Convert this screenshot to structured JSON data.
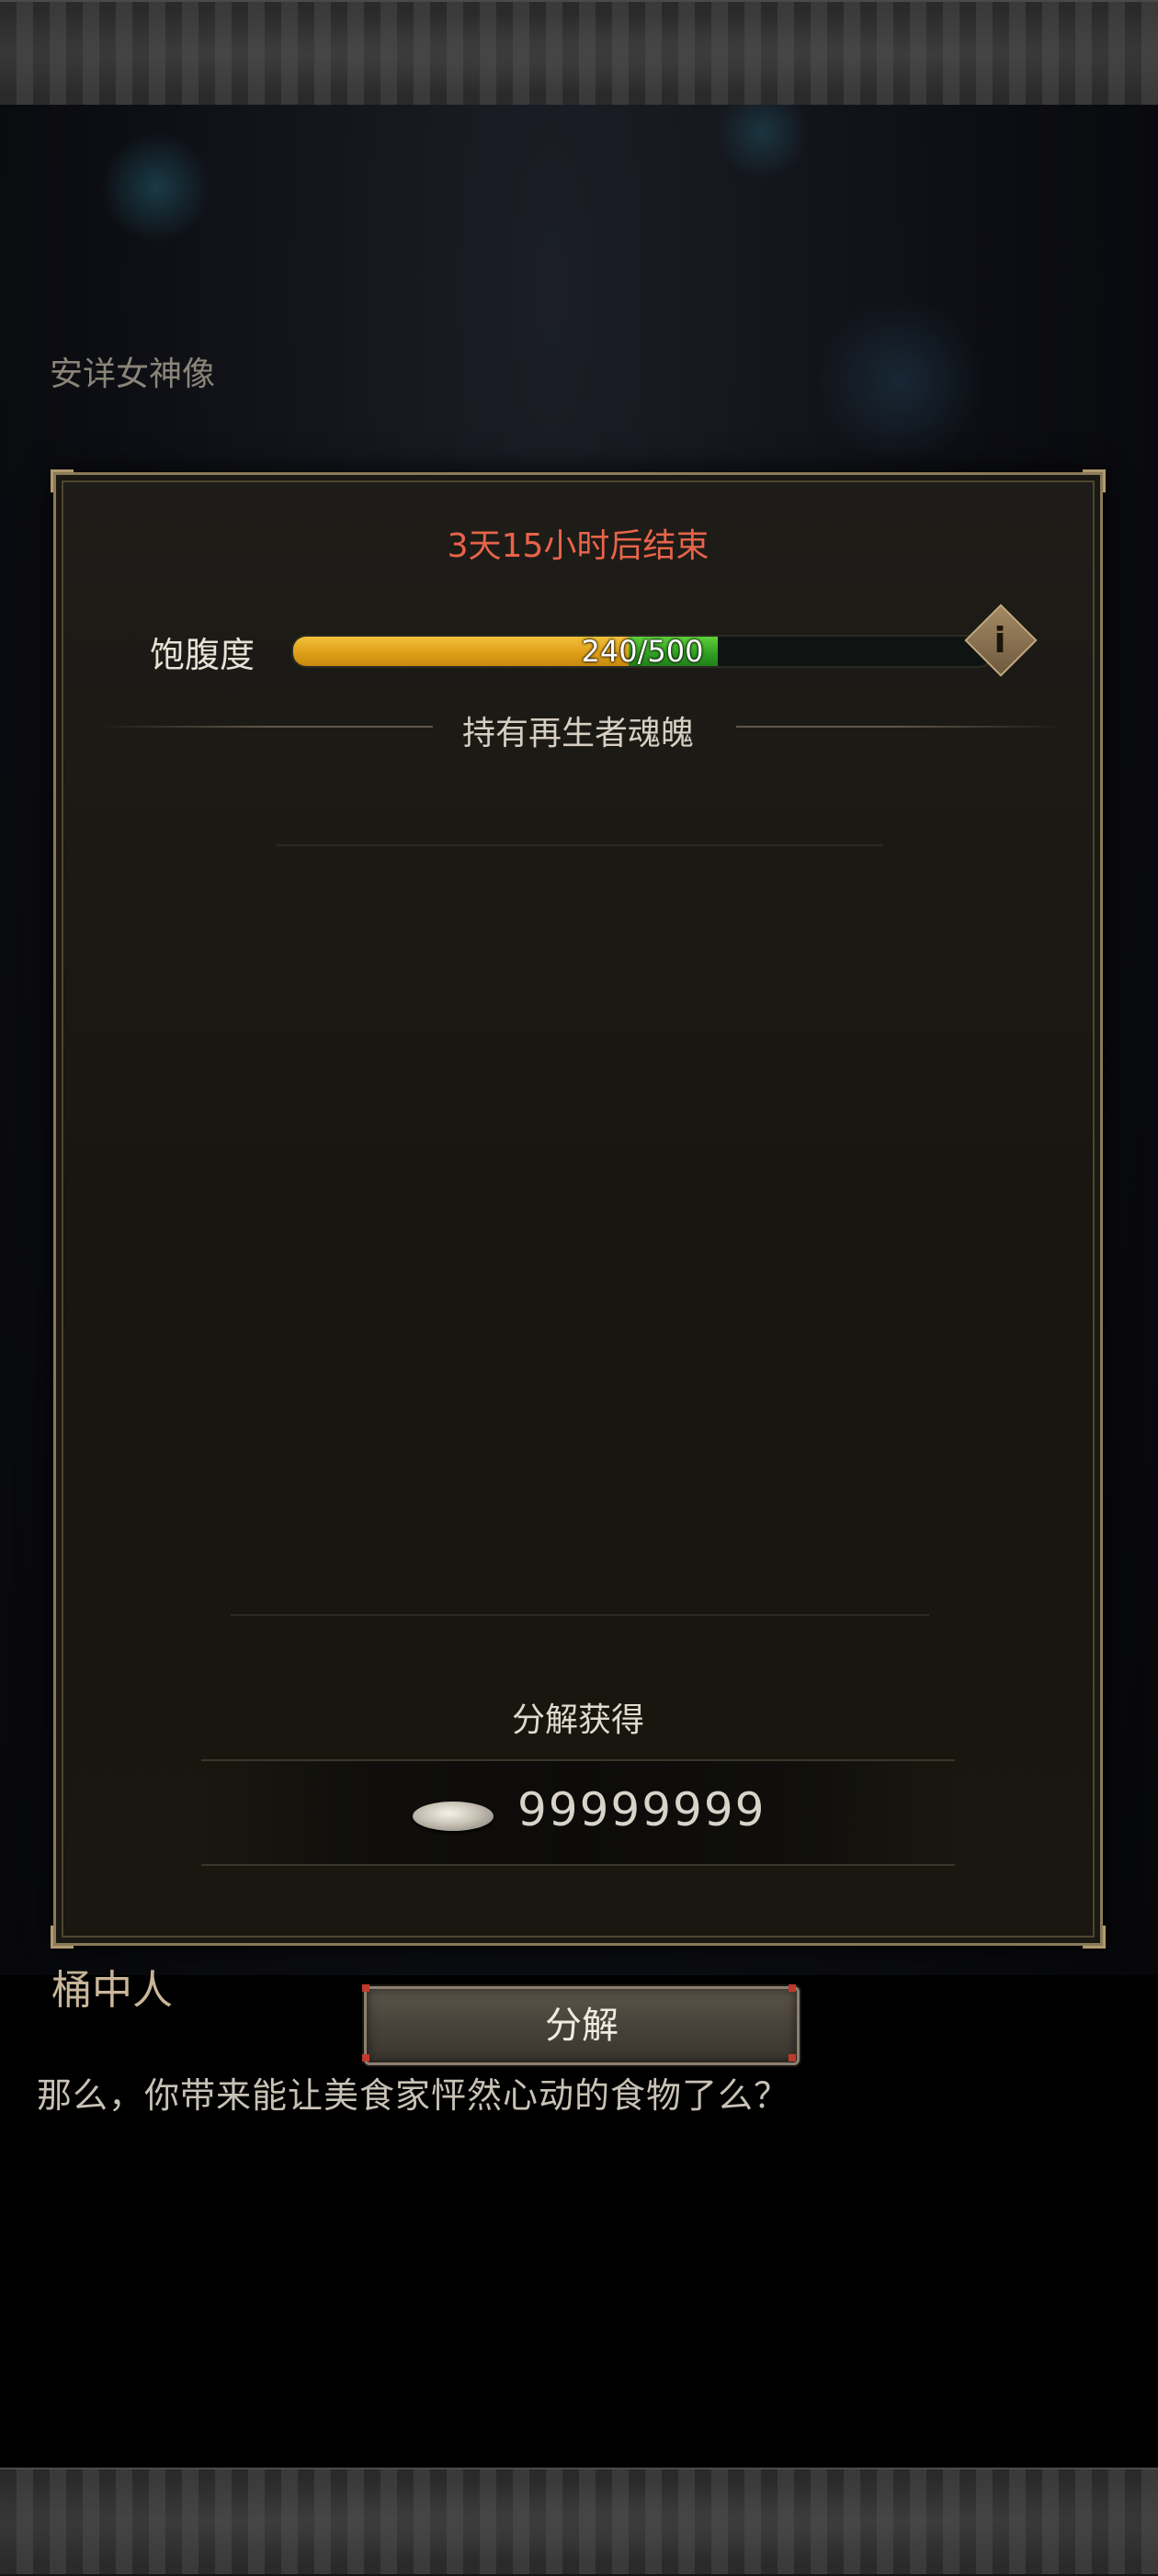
{
  "background": {
    "statue_label": "安详女神像",
    "npc_name": "桶中人",
    "dialog_text": "那么，你带来能让美食家怦然心动的食物了么？"
  },
  "panel": {
    "timer_text": "3天15小时后结束",
    "satiety": {
      "label": "饱腹度",
      "current": 240,
      "max": 500,
      "display": "240/500",
      "preview_gain_fraction": 0.128
    },
    "info_icon": "info-diamond-icon",
    "section_title": "持有再生者魂魄",
    "decompose": {
      "title": "分解获得",
      "amount": "99999999",
      "currency_icon": "silver-coin-icon"
    },
    "button_label": "分解"
  },
  "colors": {
    "timer": "#e8644a",
    "bar_fill": "#e0a21a",
    "bar_preview": "#2f9e22",
    "panel_border": "#8a7a58"
  }
}
